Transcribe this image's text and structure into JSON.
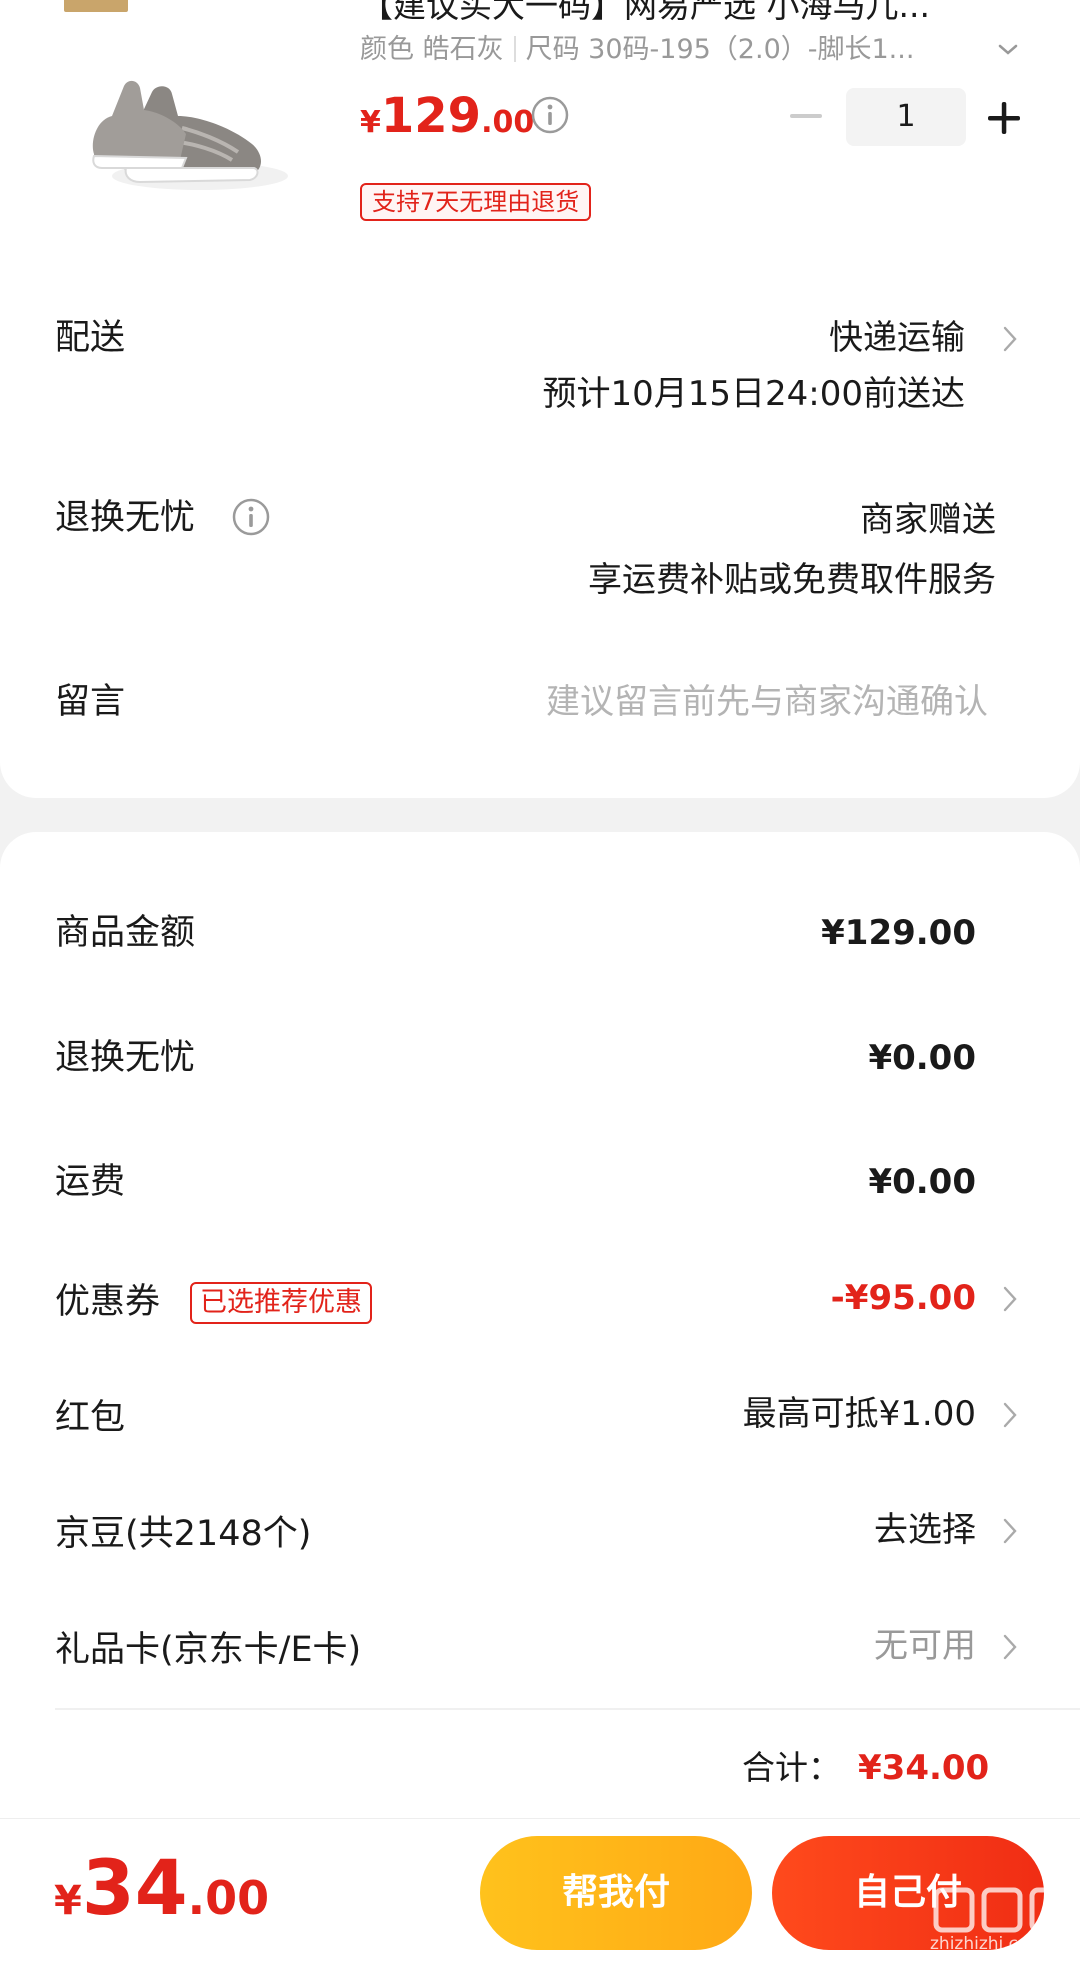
{
  "product": {
    "title": "【建议买大一码】网易严选 小海马儿...",
    "spec_color": "颜色 皓石灰",
    "spec_size": "尺码 30码-195（2.0）-脚长1...",
    "price_currency": "¥",
    "price_int": "129",
    "price_dec": ".00",
    "quantity": "1",
    "return_badge": "支持7天无理由退货"
  },
  "delivery": {
    "label": "配送",
    "method": "快递运输",
    "eta": "预计10月15日24:00前送达"
  },
  "worry_free": {
    "label": "退换无忧",
    "value_line1": "商家赠送",
    "value_line2": "享运费补贴或免费取件服务"
  },
  "message": {
    "label": "留言",
    "placeholder": "建议留言前先与商家沟通确认"
  },
  "summary": {
    "goods_label": "商品金额",
    "goods_value": "¥129.00",
    "worry_label": "退换无忧",
    "worry_value": "¥0.00",
    "shipping_label": "运费",
    "shipping_value": "¥0.00",
    "coupon_label": "优惠券",
    "coupon_badge": "已选推荐优惠",
    "coupon_value": "-¥95.00",
    "redpacket_label": "红包",
    "redpacket_value": "最高可抵¥1.00",
    "jingdou_label": "京豆(共2148个)",
    "jingdou_value": "去选择",
    "giftcard_label": "礼品卡(京东卡/E卡)",
    "giftcard_value": "无可用",
    "total_label": "合计：",
    "total_value": "¥34.00"
  },
  "bottom": {
    "currency": "¥",
    "final_int": "34",
    "final_dec": ".00",
    "help_pay": "帮我付",
    "self_pay": "自己付"
  },
  "watermark": "zhizhizhi.com",
  "colors": {
    "accent": "#e2231a",
    "help_button": "#ffb81a",
    "self_button": "#f5371a"
  }
}
